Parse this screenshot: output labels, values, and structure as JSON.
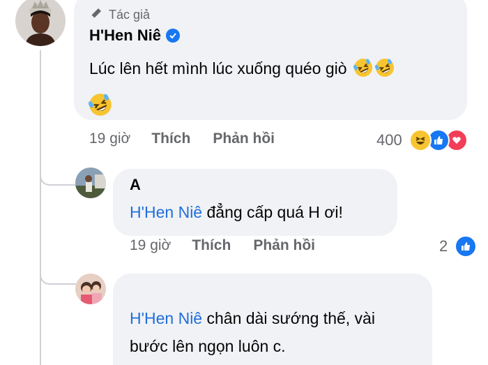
{
  "comment": {
    "badge": "Tác giả",
    "author": "H'Hen Niê",
    "text": "Lúc lên hết mình lúc xuống quéo giò",
    "time": "19 giờ",
    "like": "Thích",
    "reply": "Phản hồi",
    "reaction_count": "400",
    "reaction_icons": [
      "haha-icon",
      "like-icon",
      "love-icon"
    ],
    "emoji": "rolling-on-floor-laughing"
  },
  "replies": [
    {
      "author_visible": "A",
      "tag": "H'Hen Niê",
      "text": " đẳng cấp quá H ơi!",
      "time": "19 giờ",
      "like": "Thích",
      "reply": "Phản hồi",
      "reaction_count": "2",
      "reaction_icons": [
        "like-icon"
      ]
    },
    {
      "author_visible": "",
      "tag": "H'Hen Niê",
      "text_line1": " chân dài sướng thế, vài",
      "text_line2": "bước lên ngọn luôn c."
    }
  ],
  "colors": {
    "accent": "#1877f2",
    "tag": "#216fdb",
    "bubble": "#f0f2f5",
    "meta": "#65676b"
  }
}
